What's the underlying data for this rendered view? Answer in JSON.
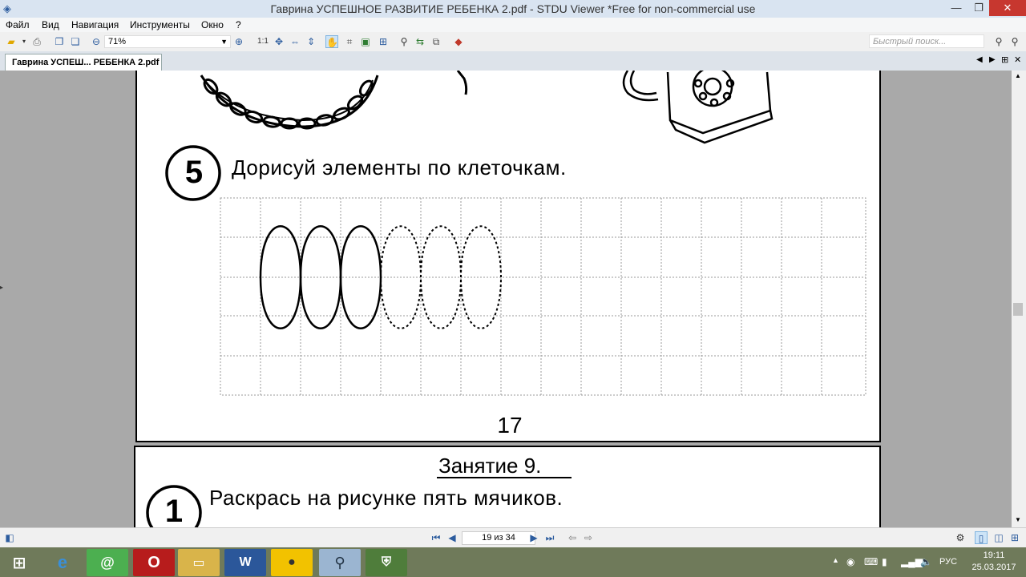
{
  "window": {
    "title": "Гаврина УСПЕШНОЕ РАЗВИТИЕ РЕБЕНКА 2.pdf - STDU Viewer *Free for non-commercial use",
    "minimize": "—",
    "maximize": "❐",
    "close": "✕"
  },
  "menu": [
    "Файл",
    "Вид",
    "Навигация",
    "Инструменты",
    "Окно",
    "?"
  ],
  "toolbar": {
    "zoom": "71%",
    "ratio_label": "1:1",
    "search_placeholder": "Быстрый поиск..."
  },
  "tab": {
    "label": "Гаврина УСПЕШ... РЕБЕНКА 2.pdf"
  },
  "document": {
    "task_number": "5",
    "task_text": "Дорисуй элементы по клеточкам.",
    "page_number": "17",
    "lesson_title": "Занятие 9.",
    "next_task_number": "1",
    "next_task_text": "Раскрась на рисунке пять мячиков.",
    "grid_columns": 16,
    "grid_rows": 5,
    "solid_loops": 3,
    "dashed_loops": 3
  },
  "status": {
    "page_indicator": "19 из 34"
  },
  "taskbar": {
    "lang": "РУС",
    "time": "19:11",
    "date": "25.03.2017"
  }
}
